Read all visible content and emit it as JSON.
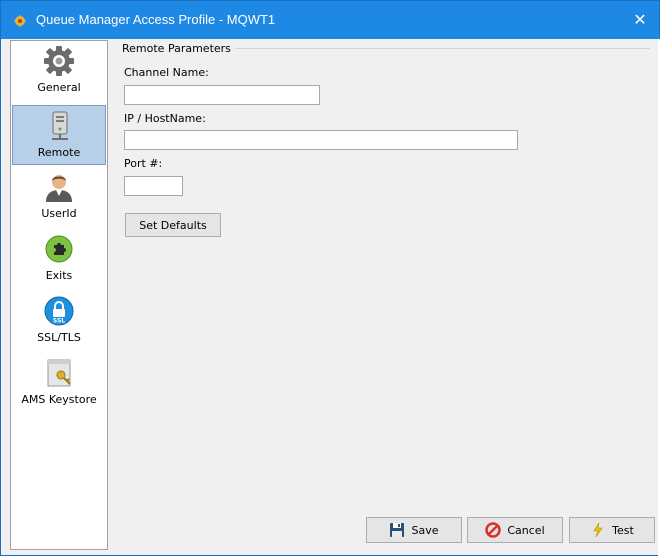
{
  "window": {
    "title": "Queue Manager Access Profile - MQWT1",
    "close_glyph": "✕"
  },
  "sidebar": {
    "items": [
      {
        "label": "General",
        "icon": "gear-icon",
        "selected": false
      },
      {
        "label": "Remote",
        "icon": "computer-tower-icon",
        "selected": true
      },
      {
        "label": "UserId",
        "icon": "user-icon",
        "selected": false
      },
      {
        "label": "Exits",
        "icon": "puzzle-icon",
        "selected": false
      },
      {
        "label": "SSL/TLS",
        "icon": "ssl-lock-icon",
        "selected": false
      },
      {
        "label": "AMS Keystore",
        "icon": "keystore-key-icon",
        "selected": false
      }
    ]
  },
  "remote": {
    "group_title": "Remote Parameters",
    "channel_name_label": "Channel Name:",
    "channel_name_value": "",
    "host_label": "IP / HostName:",
    "host_value": "",
    "port_label": "Port #:",
    "port_value": "",
    "set_defaults_label": "Set Defaults"
  },
  "footer": {
    "save_label": "Save",
    "cancel_label": "Cancel",
    "test_label": "Test"
  },
  "colors": {
    "titlebar": "#1e88e5",
    "selected_item": "#b8cfe8",
    "cancel_icon": "#d9322b",
    "test_icon": "#f2c200"
  }
}
